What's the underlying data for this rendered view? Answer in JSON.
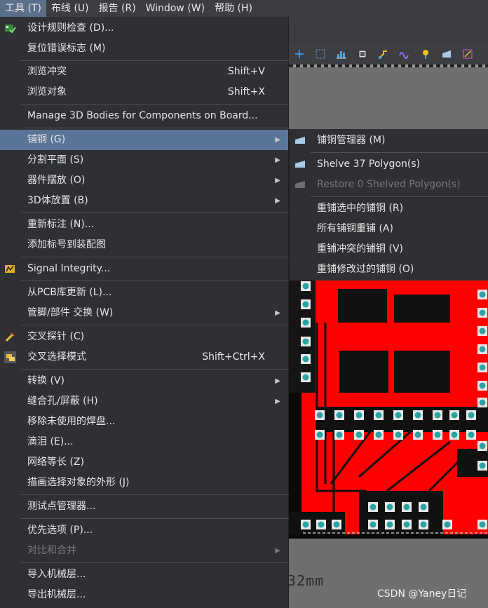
{
  "menubar": {
    "items": [
      {
        "label": "工具 (T)"
      },
      {
        "label": "布线 (U)"
      },
      {
        "label": "报告 (R)"
      },
      {
        "label": "Window (W)"
      },
      {
        "label": "帮助 (H)"
      }
    ]
  },
  "menu": {
    "items": [
      {
        "label": "设计规则检查 (D)...",
        "icon": "drc-icon"
      },
      {
        "label": "复位错误标志 (M)"
      },
      {
        "label": "浏览冲突",
        "shortcut": "Shift+V"
      },
      {
        "label": "浏览对象",
        "shortcut": "Shift+X"
      },
      {
        "label": "Manage 3D Bodies for Components on Board..."
      },
      {
        "label": "铺铜 (G)",
        "submenu": true,
        "highlighted": true
      },
      {
        "label": "分割平面 (S)",
        "submenu": true
      },
      {
        "label": "器件摆放 (O)",
        "submenu": true
      },
      {
        "label": "3D体放置 (B)",
        "submenu": true
      },
      {
        "label": "重新标注 (N)..."
      },
      {
        "label": "添加标号到装配图"
      },
      {
        "label": "Signal Integrity...",
        "icon": "signal-integrity-icon"
      },
      {
        "label": "从PCB库更新 (L)..."
      },
      {
        "label": "管脚/部件 交换 (W)",
        "submenu": true
      },
      {
        "label": "交叉探针 (C)",
        "icon": "cross-probe-icon"
      },
      {
        "label": "交叉选择模式",
        "shortcut": "Shift+Ctrl+X",
        "icon": "cross-select-icon"
      },
      {
        "label": "转换 (V)",
        "submenu": true
      },
      {
        "label": "缝合孔/屏蔽 (H)",
        "submenu": true
      },
      {
        "label": "移除未使用的焊盘..."
      },
      {
        "label": "滴泪 (E)..."
      },
      {
        "label": "网络等长 (Z)"
      },
      {
        "label": "描画选择对象的外形 (J)"
      },
      {
        "label": "测试点管理器..."
      },
      {
        "label": "优先选项 (P)..."
      },
      {
        "label": "对比和合并",
        "submenu": true,
        "disabled": true
      },
      {
        "label": "导入机械层..."
      },
      {
        "label": "导出机械层..."
      }
    ]
  },
  "submenu": {
    "items": [
      {
        "label": "铺铜管理器 (M)",
        "icon": "polygon-manager-icon"
      },
      {
        "label": "Shelve 37 Polygon(s)",
        "icon": "shelve-icon"
      },
      {
        "label": "Restore 0 Shelved Polygon(s)",
        "icon": "restore-icon",
        "disabled": true
      },
      {
        "label": "重铺选中的铺铜 (R)"
      },
      {
        "label": "所有铺铜重铺 (A)"
      },
      {
        "label": "重铺冲突的铺铜 (V)"
      },
      {
        "label": "重铺修改过的铺铜 (O)"
      }
    ]
  },
  "canvas": {
    "dimension_text": "32mm",
    "board_color": "#ff0000",
    "pad_color": "#2aa3a3"
  },
  "watermark": "CSDN @Yaney日记",
  "colors": {
    "menu_bg": "#2e3033",
    "highlight": "#5a7597",
    "menubar_bg": "#3b3d40"
  }
}
